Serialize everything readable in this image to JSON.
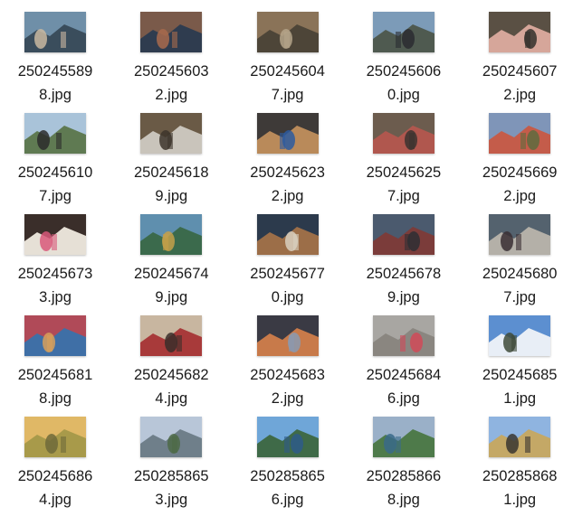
{
  "files": [
    {
      "line1": "250245589",
      "line2": "8.jpg",
      "thumb_icon": "photo-thumbnail-icon",
      "colors": [
        "#6f8fa8",
        "#3a4d5c",
        "#c9b8a0"
      ]
    },
    {
      "line1": "250245603",
      "line2": "2.jpg",
      "thumb_icon": "photo-thumbnail-icon",
      "colors": [
        "#7a5a4a",
        "#2f3c4f",
        "#a86a4c"
      ]
    },
    {
      "line1": "250245604",
      "line2": "7.jpg",
      "thumb_icon": "photo-thumbnail-icon",
      "colors": [
        "#8a7358",
        "#4d4538",
        "#b5a58a"
      ]
    },
    {
      "line1": "250245606",
      "line2": "0.jpg",
      "thumb_icon": "photo-thumbnail-icon",
      "colors": [
        "#7c9bb8",
        "#4f5a50",
        "#2a2c30"
      ]
    },
    {
      "line1": "250245607",
      "line2": "2.jpg",
      "thumb_icon": "photo-thumbnail-icon",
      "colors": [
        "#5a5044",
        "#d6a69a",
        "#33302c"
      ]
    },
    {
      "line1": "250245610",
      "line2": "7.jpg",
      "thumb_icon": "photo-thumbnail-icon",
      "colors": [
        "#a9c3d9",
        "#5f7a52",
        "#2b2b2b"
      ]
    },
    {
      "line1": "250245618",
      "line2": "9.jpg",
      "thumb_icon": "photo-thumbnail-icon",
      "colors": [
        "#6a5a46",
        "#c9c4bb",
        "#3d352b"
      ]
    },
    {
      "line1": "250245623",
      "line2": "2.jpg",
      "thumb_icon": "photo-thumbnail-icon",
      "colors": [
        "#3e3a38",
        "#b98a5a",
        "#2c5aa0"
      ]
    },
    {
      "line1": "250245625",
      "line2": "7.jpg",
      "thumb_icon": "photo-thumbnail-icon",
      "colors": [
        "#6c5c4e",
        "#b0574e",
        "#3b3330"
      ]
    },
    {
      "line1": "250245669",
      "line2": "2.jpg",
      "thumb_icon": "photo-thumbnail-icon",
      "colors": [
        "#7f95b8",
        "#c45c4a",
        "#5e6b3e"
      ]
    },
    {
      "line1": "250245673",
      "line2": "3.jpg",
      "thumb_icon": "photo-thumbnail-icon",
      "colors": [
        "#3a2e2a",
        "#e6e0d6",
        "#d8587a"
      ]
    },
    {
      "line1": "250245674",
      "line2": "9.jpg",
      "thumb_icon": "photo-thumbnail-icon",
      "colors": [
        "#5f8fae",
        "#3b6a4c",
        "#c6a04a"
      ]
    },
    {
      "line1": "250245677",
      "line2": "0.jpg",
      "thumb_icon": "photo-thumbnail-icon",
      "colors": [
        "#2c3a4c",
        "#9c6e48",
        "#d9d0c0"
      ]
    },
    {
      "line1": "250245678",
      "line2": "9.jpg",
      "thumb_icon": "photo-thumbnail-icon",
      "colors": [
        "#4b5a6e",
        "#7b3c3a",
        "#2e2e34"
      ]
    },
    {
      "line1": "250245680",
      "line2": "7.jpg",
      "thumb_icon": "photo-thumbnail-icon",
      "colors": [
        "#54626e",
        "#b4b0a8",
        "#3a2f34"
      ]
    },
    {
      "line1": "250245681",
      "line2": "8.jpg",
      "thumb_icon": "photo-thumbnail-icon",
      "colors": [
        "#b04a58",
        "#3f6fa6",
        "#d8a05a"
      ]
    },
    {
      "line1": "250245682",
      "line2": "4.jpg",
      "thumb_icon": "photo-thumbnail-icon",
      "colors": [
        "#c8b6a0",
        "#a83a3a",
        "#3a2e2a"
      ]
    },
    {
      "line1": "250245683",
      "line2": "2.jpg",
      "thumb_icon": "photo-thumbnail-icon",
      "colors": [
        "#3a3a44",
        "#c87a4a",
        "#8a9ab0"
      ]
    },
    {
      "line1": "250245684",
      "line2": "6.jpg",
      "thumb_icon": "photo-thumbnail-icon",
      "colors": [
        "#a8a6a2",
        "#8a8680",
        "#d04a58"
      ]
    },
    {
      "line1": "250245685",
      "line2": "1.jpg",
      "thumb_icon": "photo-thumbnail-icon",
      "colors": [
        "#5c8fd0",
        "#e8eef6",
        "#3e4a38"
      ]
    },
    {
      "line1": "250245686",
      "line2": "4.jpg",
      "thumb_icon": "photo-thumbnail-icon",
      "colors": [
        "#e0b866",
        "#a89a4a",
        "#6e6a3a"
      ]
    },
    {
      "line1": "250285865",
      "line2": "3.jpg",
      "thumb_icon": "photo-thumbnail-icon",
      "colors": [
        "#b8c6d8",
        "#6f7f8a",
        "#4e6a46"
      ]
    },
    {
      "line1": "250285865",
      "line2": "6.jpg",
      "thumb_icon": "photo-thumbnail-icon",
      "colors": [
        "#6fa6d8",
        "#3f6a48",
        "#2e5a8a"
      ]
    },
    {
      "line1": "250285866",
      "line2": "8.jpg",
      "thumb_icon": "photo-thumbnail-icon",
      "colors": [
        "#9ab0c8",
        "#4e7a4a",
        "#3a6a8a"
      ]
    },
    {
      "line1": "250285868",
      "line2": "1.jpg",
      "thumb_icon": "photo-thumbnail-icon",
      "colors": [
        "#8fb4e0",
        "#c4a866",
        "#3a3630"
      ]
    }
  ]
}
